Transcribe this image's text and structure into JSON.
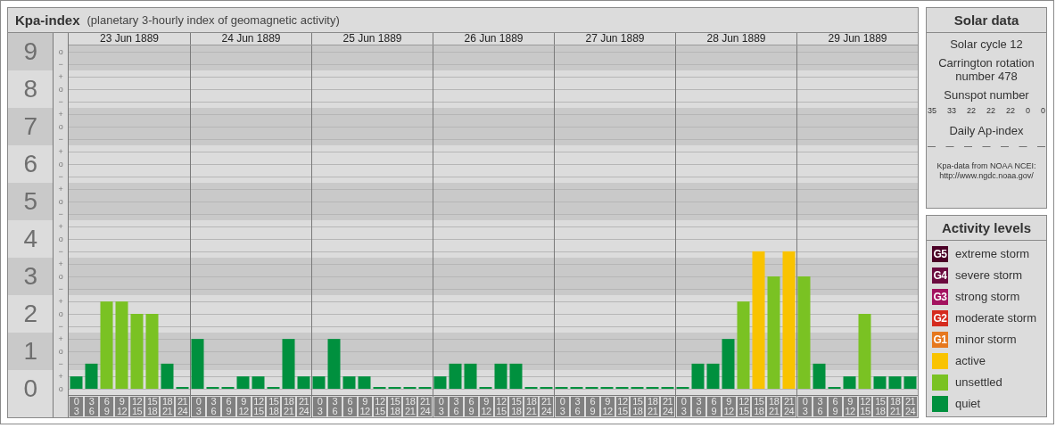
{
  "kpa_panel": {
    "title": "Kpa-index",
    "subtitle": "(planetary 3-hourly index of geomagnetic activity)",
    "minor_marks": [
      [
        "o",
        "−"
      ],
      [
        "+",
        "o",
        "−"
      ],
      [
        "+",
        "o",
        "−"
      ],
      [
        "+",
        "o",
        "−"
      ],
      [
        "+",
        "o",
        "−"
      ],
      [
        "+",
        "o",
        "−"
      ],
      [
        "+",
        "o",
        "−"
      ],
      [
        "+",
        "o",
        "−"
      ],
      [
        "+",
        "o",
        "−"
      ],
      [
        "+",
        "o"
      ]
    ],
    "days": [
      {
        "date": "23 Jun 1889",
        "slots": [
          {
            "from": "0",
            "to": "3"
          },
          {
            "from": "3",
            "to": "6"
          },
          {
            "from": "6",
            "to": "9"
          },
          {
            "from": "9",
            "to": "12"
          },
          {
            "from": "12",
            "to": "15"
          },
          {
            "from": "15",
            "to": "18"
          },
          {
            "from": "18",
            "to": "21"
          },
          {
            "from": "21",
            "to": "24"
          }
        ]
      },
      {
        "date": "24 Jun 1889",
        "slots": [
          {
            "from": "0",
            "to": "3"
          },
          {
            "from": "3",
            "to": "6"
          },
          {
            "from": "6",
            "to": "9"
          },
          {
            "from": "9",
            "to": "12"
          },
          {
            "from": "12",
            "to": "15"
          },
          {
            "from": "15",
            "to": "18"
          },
          {
            "from": "18",
            "to": "21"
          },
          {
            "from": "21",
            "to": "24"
          }
        ]
      },
      {
        "date": "25 Jun 1889",
        "slots": [
          {
            "from": "0",
            "to": "3"
          },
          {
            "from": "3",
            "to": "6"
          },
          {
            "from": "6",
            "to": "9"
          },
          {
            "from": "9",
            "to": "12"
          },
          {
            "from": "12",
            "to": "15"
          },
          {
            "from": "15",
            "to": "18"
          },
          {
            "from": "18",
            "to": "21"
          },
          {
            "from": "21",
            "to": "24"
          }
        ]
      },
      {
        "date": "26 Jun 1889",
        "slots": [
          {
            "from": "0",
            "to": "3"
          },
          {
            "from": "3",
            "to": "6"
          },
          {
            "from": "6",
            "to": "9"
          },
          {
            "from": "9",
            "to": "12"
          },
          {
            "from": "12",
            "to": "15"
          },
          {
            "from": "15",
            "to": "18"
          },
          {
            "from": "18",
            "to": "21"
          },
          {
            "from": "21",
            "to": "24"
          }
        ]
      },
      {
        "date": "27 Jun 1889",
        "slots": [
          {
            "from": "0",
            "to": "3"
          },
          {
            "from": "3",
            "to": "6"
          },
          {
            "from": "6",
            "to": "9"
          },
          {
            "from": "9",
            "to": "12"
          },
          {
            "from": "12",
            "to": "15"
          },
          {
            "from": "15",
            "to": "18"
          },
          {
            "from": "18",
            "to": "21"
          },
          {
            "from": "21",
            "to": "24"
          }
        ]
      },
      {
        "date": "28 Jun 1889",
        "slots": [
          {
            "from": "0",
            "to": "3"
          },
          {
            "from": "3",
            "to": "6"
          },
          {
            "from": "6",
            "to": "9"
          },
          {
            "from": "9",
            "to": "12"
          },
          {
            "from": "12",
            "to": "15"
          },
          {
            "from": "15",
            "to": "18"
          },
          {
            "from": "18",
            "to": "21"
          },
          {
            "from": "21",
            "to": "24"
          }
        ]
      },
      {
        "date": "29 Jun 1889",
        "slots": [
          {
            "from": "0",
            "to": "3"
          },
          {
            "from": "3",
            "to": "6"
          },
          {
            "from": "6",
            "to": "9"
          },
          {
            "from": "9",
            "to": "12"
          },
          {
            "from": "12",
            "to": "15"
          },
          {
            "from": "15",
            "to": "18"
          },
          {
            "from": "18",
            "to": "21"
          },
          {
            "from": "21",
            "to": "24"
          }
        ]
      }
    ],
    "chart_data": {
      "type": "bar",
      "ylim": [
        0,
        9
      ],
      "grid": true,
      "categories": [
        null,
        null,
        null,
        null,
        null,
        null,
        null,
        null,
        null,
        null,
        null,
        null,
        null,
        null,
        null,
        null,
        null,
        null,
        null,
        null,
        null,
        null,
        null,
        null,
        null,
        null,
        null,
        null,
        null,
        null,
        null,
        null,
        null,
        null,
        null,
        null,
        null,
        null,
        null,
        null,
        null,
        null,
        null,
        null,
        null,
        null,
        null,
        null,
        null,
        null,
        null,
        null,
        null,
        null,
        null,
        null
      ],
      "yticks": [
        {
          "value": 0,
          "label": "0"
        },
        {
          "value": 1,
          "label": "1"
        },
        {
          "value": 2,
          "label": "2"
        },
        {
          "value": 3,
          "label": "3"
        },
        {
          "value": 4,
          "label": "4"
        },
        {
          "value": 5,
          "label": "5"
        },
        {
          "value": 6,
          "label": "6"
        },
        {
          "value": 7,
          "label": "7"
        },
        {
          "value": 8,
          "label": "8"
        },
        {
          "value": 9,
          "label": "9"
        }
      ],
      "series": [
        {
          "color": "#00903e",
          "values": [
            0.33,
            0.67,
            null,
            null,
            null,
            null,
            0.67,
            0,
            1.33,
            0,
            0,
            0.33,
            0.33,
            0,
            1.33,
            0.33,
            0.33,
            1.33,
            0.33,
            0.33,
            0,
            0,
            0,
            0,
            0.33,
            0.67,
            0.67,
            0,
            0.67,
            0.67,
            0,
            0,
            0,
            0,
            0,
            0,
            0,
            0,
            0,
            0,
            0,
            0.67,
            0.67,
            1.33,
            null,
            null,
            null,
            null,
            null,
            0.67,
            0,
            0.33,
            null,
            0.33,
            0.33,
            0.33
          ]
        },
        {
          "color": "#7ac223",
          "values": [
            null,
            null,
            2.33,
            2.33,
            2,
            2,
            null,
            null,
            null,
            null,
            null,
            null,
            null,
            null,
            null,
            null,
            null,
            null,
            null,
            null,
            null,
            null,
            null,
            null,
            null,
            null,
            null,
            null,
            null,
            null,
            null,
            null,
            null,
            null,
            null,
            null,
            null,
            null,
            null,
            null,
            null,
            null,
            null,
            null,
            2.33,
            null,
            3,
            null,
            3,
            null,
            null,
            null,
            2,
            null,
            null,
            null
          ]
        },
        {
          "color": "#f9c300",
          "values": [
            null,
            null,
            null,
            null,
            null,
            null,
            null,
            null,
            null,
            null,
            null,
            null,
            null,
            null,
            null,
            null,
            null,
            null,
            null,
            null,
            null,
            null,
            null,
            null,
            null,
            null,
            null,
            null,
            null,
            null,
            null,
            null,
            null,
            null,
            null,
            null,
            null,
            null,
            null,
            null,
            null,
            null,
            null,
            null,
            null,
            3.67,
            null,
            3.67,
            null,
            null,
            null,
            null,
            null,
            null,
            null,
            null
          ]
        }
      ]
    }
  },
  "solar_data": {
    "title": "Solar data",
    "solar_cycle": "Solar cycle 12",
    "carrington": "Carrington rotation number 478",
    "sunspot_title": "Sunspot number",
    "sunspots": [
      "35",
      "33",
      "22",
      "22",
      "22",
      "0",
      "0"
    ],
    "ap_title": "Daily Ap-index",
    "ap_values": [
      "—",
      "—",
      "—",
      "—",
      "—",
      "—",
      "—"
    ],
    "source_lines": [
      "Kpa-data from NOAA NCEI:",
      "http://www.ngdc.noaa.gov/"
    ]
  },
  "activity_levels": {
    "title": "Activity levels",
    "items": [
      {
        "badge": "G5",
        "label": "extreme storm",
        "color": "#4b0026"
      },
      {
        "badge": "G4",
        "label": "severe storm",
        "color": "#6b0a3f"
      },
      {
        "badge": "G3",
        "label": "strong storm",
        "color": "#a3125f"
      },
      {
        "badge": "G2",
        "label": "moderate storm",
        "color": "#d52b1e"
      },
      {
        "badge": "G1",
        "label": "minor storm",
        "color": "#e6781e"
      },
      {
        "label": "active",
        "color": "#f9c300"
      },
      {
        "label": "unsettled",
        "color": "#7ac223"
      },
      {
        "label": "quiet",
        "color": "#00903e"
      }
    ]
  }
}
